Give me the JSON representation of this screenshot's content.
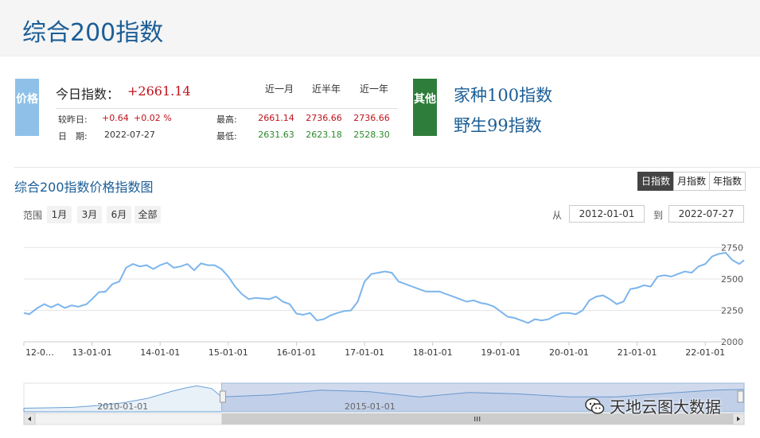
{
  "page_title": "综合200指数",
  "price_tag": "价格",
  "other_tag": "其他",
  "today": {
    "label": "今日指数：",
    "value": "+2661.14"
  },
  "columns": [
    "近一月",
    "近半年",
    "近一年"
  ],
  "prev": {
    "label": "较昨日:",
    "change": "+0.64",
    "pct": "+0.02 %"
  },
  "date": {
    "label": "日　期:",
    "value": "2022-07-27"
  },
  "high": {
    "label": "最高:",
    "values": [
      "2661.14",
      "2736.66",
      "2736.66"
    ]
  },
  "low": {
    "label": "最低:",
    "values": [
      "2631.63",
      "2623.18",
      "2528.30"
    ]
  },
  "other_links": [
    "家种100指数",
    "野生99指数"
  ],
  "chart_title": "综合200指数价格指数图",
  "period_buttons": [
    "日指数",
    "月指数",
    "年指数"
  ],
  "range": {
    "label": "范围",
    "buttons": [
      "1月",
      "3月",
      "6月",
      "全部"
    ]
  },
  "dates": {
    "from_label": "从",
    "from": "2012-01-01",
    "to_label": "到",
    "to": "2022-07-27"
  },
  "navigator_labels": [
    "2010-01-01",
    "2015-01-01"
  ],
  "watermark": "天地云图大数据",
  "colors": {
    "line": "#7cb5ec",
    "title": "#1b5e96",
    "up": "#c0121a",
    "down": "#2a8a2a"
  },
  "chart_data": {
    "type": "line",
    "x_ticks": [
      "12-0…",
      "13-01-01",
      "14-01-01",
      "15-01-01",
      "16-01-01",
      "17-01-01",
      "18-01-01",
      "19-01-01",
      "20-01-01",
      "21-01-01",
      "22-01-01"
    ],
    "y_ticks": [
      2000,
      2250,
      2500,
      2750
    ],
    "ylim": [
      2000,
      2880
    ],
    "xlim": [
      2012.0,
      2022.57
    ],
    "series": [
      {
        "x": [
          2012.0,
          2012.08,
          2012.2,
          2012.3,
          2012.4,
          2012.5,
          2012.6,
          2012.7,
          2012.8,
          2012.92,
          2013.0,
          2013.1,
          2013.2,
          2013.3,
          2013.4,
          2013.5,
          2013.6,
          2013.7,
          2013.8,
          2013.9,
          2014.0,
          2014.1,
          2014.2,
          2014.3,
          2014.4,
          2014.5,
          2014.6,
          2014.7,
          2014.8,
          2014.9,
          2015.0,
          2015.1,
          2015.2,
          2015.3,
          2015.4,
          2015.5,
          2015.6,
          2015.7,
          2015.8,
          2015.9,
          2016.0,
          2016.1,
          2016.2,
          2016.3,
          2016.4,
          2016.5,
          2016.6,
          2016.7,
          2016.8,
          2016.9,
          2017.0,
          2017.1,
          2017.2,
          2017.3,
          2017.4,
          2017.5,
          2017.6,
          2017.7,
          2017.8,
          2017.9,
          2018.0,
          2018.1,
          2018.2,
          2018.3,
          2018.4,
          2018.5,
          2018.6,
          2018.7,
          2018.8,
          2018.9,
          2019.0,
          2019.1,
          2019.2,
          2019.3,
          2019.4,
          2019.5,
          2019.6,
          2019.7,
          2019.8,
          2019.9,
          2020.0,
          2020.1,
          2020.2,
          2020.3,
          2020.4,
          2020.5,
          2020.6,
          2020.7,
          2020.8,
          2020.9,
          2021.0,
          2021.1,
          2021.2,
          2021.3,
          2021.4,
          2021.5,
          2021.6,
          2021.7,
          2021.8,
          2021.9,
          2022.0,
          2022.1,
          2022.2,
          2022.3,
          2022.4,
          2022.5,
          2022.57
        ],
        "y": [
          2230,
          2220,
          2270,
          2300,
          2275,
          2300,
          2270,
          2290,
          2280,
          2300,
          2340,
          2395,
          2400,
          2460,
          2480,
          2590,
          2620,
          2600,
          2610,
          2580,
          2610,
          2630,
          2590,
          2600,
          2620,
          2570,
          2625,
          2610,
          2610,
          2580,
          2520,
          2440,
          2380,
          2340,
          2350,
          2345,
          2340,
          2360,
          2320,
          2300,
          2225,
          2215,
          2230,
          2170,
          2180,
          2210,
          2230,
          2245,
          2250,
          2320,
          2480,
          2540,
          2550,
          2560,
          2550,
          2480,
          2460,
          2440,
          2420,
          2400,
          2400,
          2400,
          2380,
          2360,
          2340,
          2320,
          2330,
          2310,
          2300,
          2280,
          2240,
          2200,
          2190,
          2170,
          2150,
          2180,
          2170,
          2180,
          2210,
          2230,
          2230,
          2220,
          2250,
          2330,
          2360,
          2370,
          2340,
          2300,
          2320,
          2420,
          2430,
          2450,
          2440,
          2520,
          2530,
          2520,
          2540,
          2560,
          2550,
          2600,
          2620,
          2680,
          2700,
          2710,
          2650,
          2620,
          2650
        ]
      }
    ],
    "navigator": {
      "xlim": [
        2008.0,
        2022.57
      ],
      "x_ticks": [
        "2010-01-01",
        "2015-01-01"
      ],
      "selected": [
        2012.0,
        2022.57
      ],
      "x": [
        2008.0,
        2008.5,
        2009.0,
        2009.5,
        2010.0,
        2010.5,
        2011.0,
        2011.3,
        2011.5,
        2011.8,
        2012.0,
        2013.0,
        2014.0,
        2015.0,
        2016.0,
        2017.0,
        2018.0,
        2019.0,
        2020.0,
        2021.0,
        2022.0,
        2022.57
      ],
      "y": [
        1600,
        1620,
        1650,
        1750,
        1900,
        2150,
        2550,
        2750,
        2850,
        2700,
        2230,
        2340,
        2610,
        2520,
        2225,
        2480,
        2400,
        2240,
        2230,
        2430,
        2620,
        2650
      ]
    },
    "xlabel": "",
    "ylabel": "",
    "grid": true,
    "legend": "none"
  }
}
